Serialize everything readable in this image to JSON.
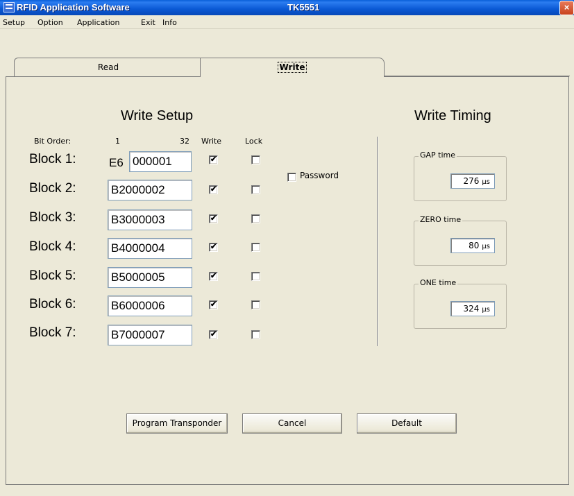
{
  "window": {
    "title": "RFID Application Software",
    "subtitle": "TK5551",
    "close_glyph": "×"
  },
  "menu": [
    "Setup",
    "Option",
    "Application",
    "Exit",
    "Info"
  ],
  "tabs": [
    {
      "label": "Read",
      "selected": false
    },
    {
      "label": "Write",
      "selected": true
    }
  ],
  "write_setup": {
    "title": "Write Setup",
    "bit_order_label": "Bit Order:",
    "bit_start": "1",
    "bit_end": "32",
    "col_write": "Write",
    "col_lock": "Lock",
    "password_label": "Password",
    "password_checked": false,
    "blocks": [
      {
        "label": "Block 1:",
        "prefix": "E6",
        "value": "000001",
        "write": true,
        "lock": false
      },
      {
        "label": "Block 2:",
        "value": "B2000002",
        "write": true,
        "lock": false
      },
      {
        "label": "Block 3:",
        "value": "B3000003",
        "write": true,
        "lock": false
      },
      {
        "label": "Block 4:",
        "value": "B4000004",
        "write": true,
        "lock": false
      },
      {
        "label": "Block 5:",
        "value": "B5000005",
        "write": true,
        "lock": false
      },
      {
        "label": "Block 6:",
        "value": "B6000006",
        "write": true,
        "lock": false
      },
      {
        "label": "Block 7:",
        "value": "B7000007",
        "write": true,
        "lock": false
      }
    ]
  },
  "write_timing": {
    "title": "Write Timing",
    "unit": "µs",
    "gap": {
      "label": "GAP time",
      "value": "276"
    },
    "zero": {
      "label": "ZERO time",
      "value": "80"
    },
    "one": {
      "label": "ONE time",
      "value": "324"
    }
  },
  "buttons": {
    "program": "Program Transponder",
    "cancel": "Cancel",
    "default": "Default"
  },
  "colors": {
    "titlebar": "#0a58d4",
    "window_bg": "#ece9d8",
    "close": "#c8431d"
  },
  "icons": {
    "app": "rfid-app-icon",
    "close": "close-icon",
    "check": "checkmark-icon"
  }
}
